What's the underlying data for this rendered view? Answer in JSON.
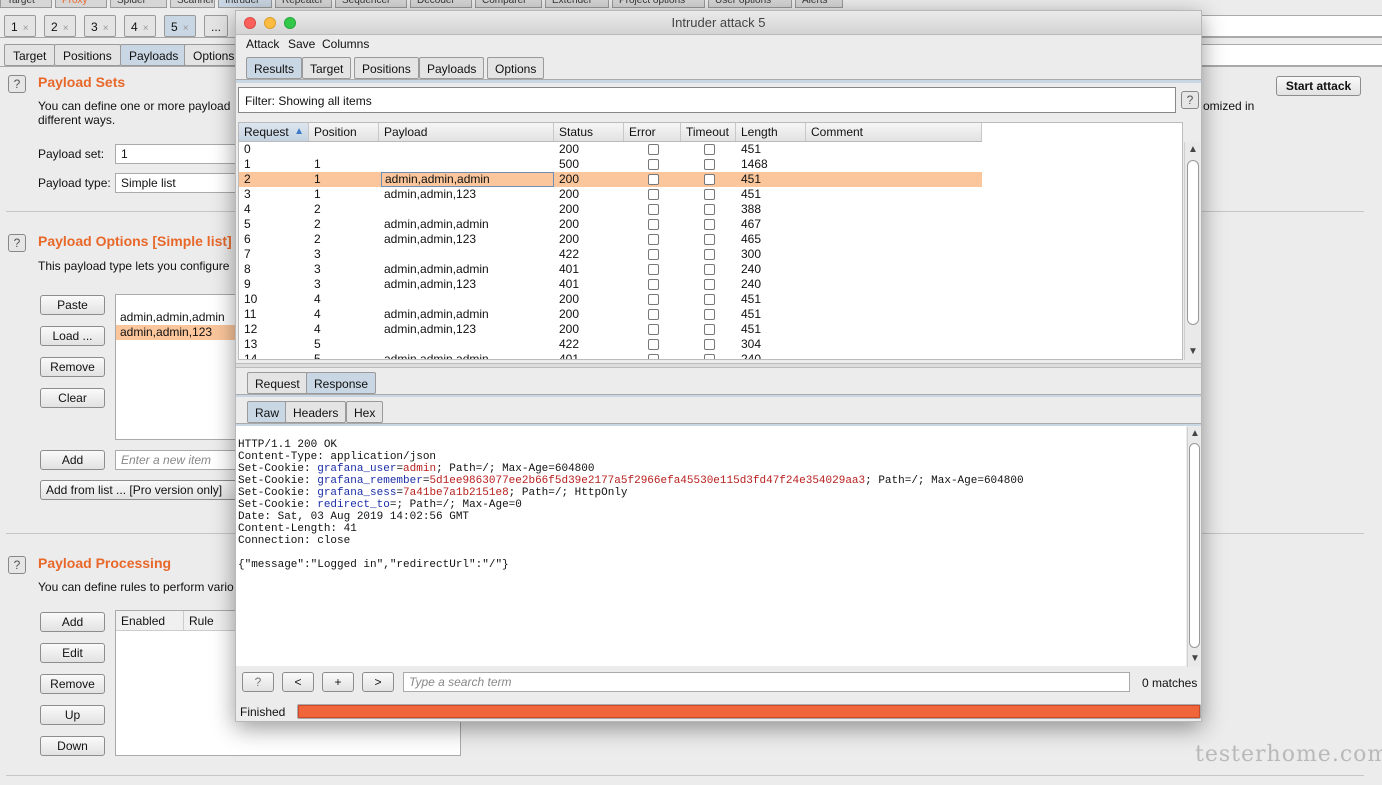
{
  "main_tabs": [
    "Target",
    "Proxy",
    "Spider",
    "Scanner",
    "Intruder",
    "Repeater",
    "Sequencer",
    "Decoder",
    "Comparer",
    "Extender",
    "Project options",
    "User options",
    "Alerts"
  ],
  "attack_tabs": [
    {
      "label": "1",
      "close": "×"
    },
    {
      "label": "2",
      "close": "×"
    },
    {
      "label": "3",
      "close": "×"
    },
    {
      "label": "4",
      "close": "×"
    },
    {
      "label": "5",
      "close": "×"
    },
    {
      "label": "...",
      "close": ""
    }
  ],
  "sub_tabs": [
    "Target",
    "Positions",
    "Payloads",
    "Options"
  ],
  "start_attack": "Start attack",
  "help_glyph": "?",
  "payload_sets": {
    "title": "Payload Sets",
    "desc_line1": "You can define one or more payload",
    "desc_right": "omized in",
    "desc_line2": "different ways.",
    "set_label": "Payload set:",
    "set_value": "1",
    "type_label": "Payload type:",
    "type_value": "Simple list"
  },
  "payload_options": {
    "title": "Payload Options [Simple list]",
    "desc": "This payload type lets you configure",
    "buttons": [
      "Paste",
      "Load ...",
      "Remove",
      "Clear"
    ],
    "items": [
      "admin,admin,admin",
      "admin,admin,123"
    ],
    "add_label": "Add",
    "add_placeholder": "Enter a new item",
    "add_from_list": "Add from list ... [Pro version only]"
  },
  "payload_processing": {
    "title": "Payload Processing",
    "desc": "You can define rules to perform vario",
    "buttons": [
      "Add",
      "Edit",
      "Remove",
      "Up",
      "Down"
    ],
    "columns": [
      "Enabled",
      "Rule"
    ]
  },
  "window": {
    "title": "Intruder attack 5",
    "menu": [
      "Attack",
      "Save",
      "Columns"
    ],
    "tabs": [
      "Results",
      "Target",
      "Positions",
      "Payloads",
      "Options"
    ],
    "filter": "Filter: Showing all items",
    "columns": [
      "Request",
      "Position",
      "Payload",
      "Status",
      "Error",
      "Timeout",
      "Length",
      "Comment"
    ],
    "sort_indicator": "▲",
    "rows": [
      {
        "request": "0",
        "position": "",
        "payload": "",
        "status": "200",
        "length": "451"
      },
      {
        "request": "1",
        "position": "1",
        "payload": "",
        "status": "500",
        "length": "1468"
      },
      {
        "request": "2",
        "position": "1",
        "payload": "admin,admin,admin",
        "status": "200",
        "length": "451"
      },
      {
        "request": "3",
        "position": "1",
        "payload": "admin,admin,123",
        "status": "200",
        "length": "451"
      },
      {
        "request": "4",
        "position": "2",
        "payload": "",
        "status": "200",
        "length": "388"
      },
      {
        "request": "5",
        "position": "2",
        "payload": "admin,admin,admin",
        "status": "200",
        "length": "467"
      },
      {
        "request": "6",
        "position": "2",
        "payload": "admin,admin,123",
        "status": "200",
        "length": "465"
      },
      {
        "request": "7",
        "position": "3",
        "payload": "",
        "status": "422",
        "length": "300"
      },
      {
        "request": "8",
        "position": "3",
        "payload": "admin,admin,admin",
        "status": "401",
        "length": "240"
      },
      {
        "request": "9",
        "position": "3",
        "payload": "admin,admin,123",
        "status": "401",
        "length": "240"
      },
      {
        "request": "10",
        "position": "4",
        "payload": "",
        "status": "200",
        "length": "451"
      },
      {
        "request": "11",
        "position": "4",
        "payload": "admin,admin,admin",
        "status": "200",
        "length": "451"
      },
      {
        "request": "12",
        "position": "4",
        "payload": "admin,admin,123",
        "status": "200",
        "length": "451"
      },
      {
        "request": "13",
        "position": "5",
        "payload": "",
        "status": "422",
        "length": "304"
      },
      {
        "request": "14",
        "position": "5",
        "payload": "admin,admin,admin",
        "status": "401",
        "length": "240"
      }
    ],
    "selected_row": 2,
    "rr_tabs": [
      "Request",
      "Response"
    ],
    "view_tabs": [
      "Raw",
      "Headers",
      "Hex"
    ],
    "response": {
      "status_line": "HTTP/1.1 200 OK",
      "content_type": "Content-Type: application/json",
      "h_set_cookie": "Set-Cookie: ",
      "c1_name": "grafana_user",
      "c1_eq": "=",
      "c1_val": "admin",
      "c1_rest": "; Path=/; Max-Age=604800",
      "c2_name": "grafana_remember",
      "c2_eq": "=",
      "c2_val": "5d1ee9863077ee2b66f5d39e2177a5f2966efa45530e115d3fd47f24e354029aa3",
      "c2_rest": "; Path=/; Max-Age=604800",
      "c3_name": "grafana_sess",
      "c3_eq": "=",
      "c3_val": "7a41be7a1b2151e8",
      "c3_rest": "; Path=/; HttpOnly",
      "c4_name": "redirect_to",
      "c4_eq": "=",
      "c4_val": "",
      "c4_rest": "; Path=/; Max-Age=0",
      "date": "Date: Sat, 03 Aug 2019 14:02:56 GMT",
      "content_length": "Content-Length: 41",
      "connection": "Connection: close",
      "body": "{\"message\":\"Logged in\",\"redirectUrl\":\"/\"}"
    },
    "search": {
      "help": "?",
      "prev": "<",
      "add": "+",
      "next": ">",
      "placeholder": "Type a search term",
      "matches": "0 matches"
    },
    "status": "Finished",
    "progress": 1.0,
    "progress_color": "#f0663a"
  },
  "watermark": "testerhome.com",
  "colors": {
    "accent": "#e8682a",
    "row_highlight": "#fbc69c",
    "tab_selected": "#c9d6e3"
  }
}
